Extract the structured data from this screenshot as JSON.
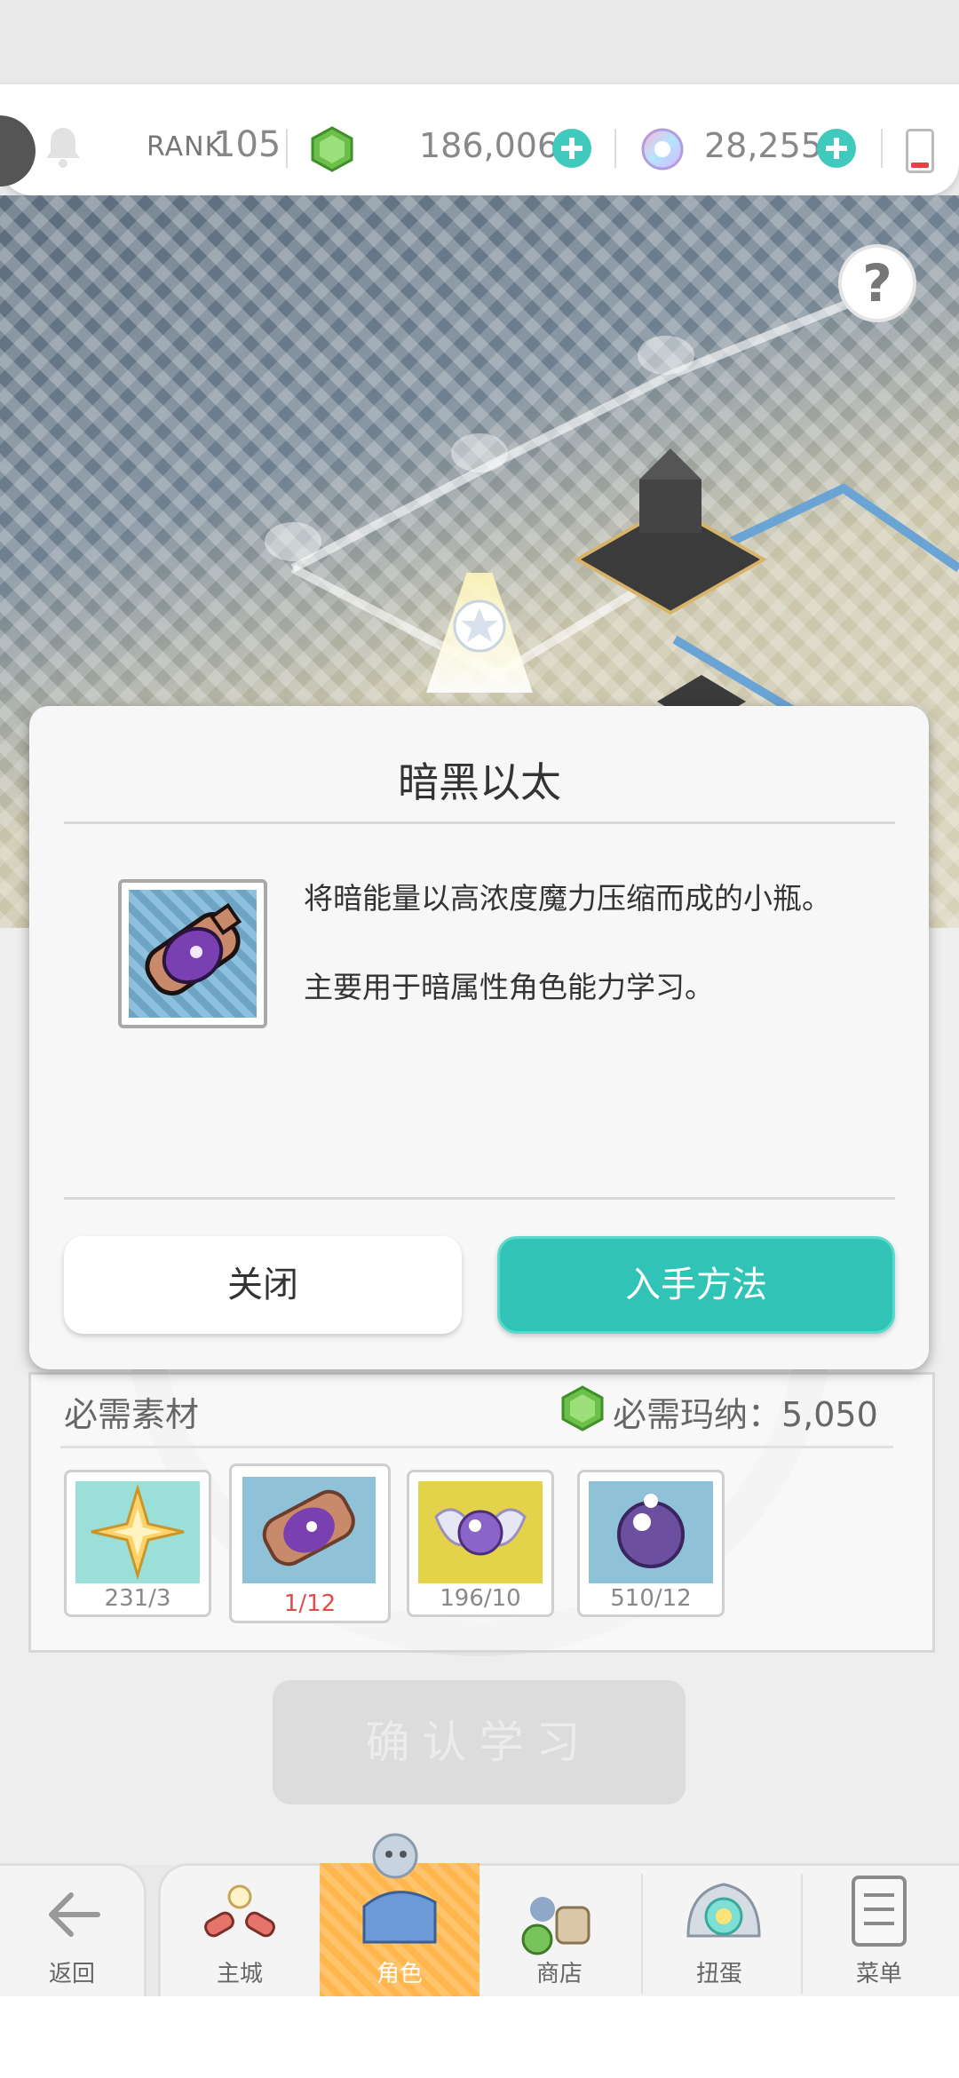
{
  "status_bar": {
    "rank_label": "RANK",
    "rank_value": "105",
    "mana": "186,006",
    "jewels": "28,255"
  },
  "map": {
    "help_symbol": "?"
  },
  "dialog": {
    "title": "暗黑以太",
    "description_line1": "将暗能量以高浓度魔力压缩而成的小瓶。",
    "description_line2": "主要用于暗属性角色能力学习。",
    "close_label": "关闭",
    "obtain_label": "入手方法"
  },
  "materials": {
    "title": "必需素材",
    "mana_required": "必需玛纳：5,050",
    "items": [
      {
        "count": "231/3",
        "insufficient": false
      },
      {
        "count": "1/12",
        "insufficient": true
      },
      {
        "count": "196/10",
        "insufficient": false
      },
      {
        "count": "510/12",
        "insufficient": false
      }
    ]
  },
  "confirm_label": "确认学习",
  "nav": {
    "back": "返回",
    "home": "主城",
    "character": "角色",
    "shop": "商店",
    "gacha": "扭蛋",
    "menu": "菜单"
  },
  "colors": {
    "accent_teal": "#31c4b6",
    "active_tab": "#ffb74d",
    "insufficient_red": "#e24b4b"
  }
}
